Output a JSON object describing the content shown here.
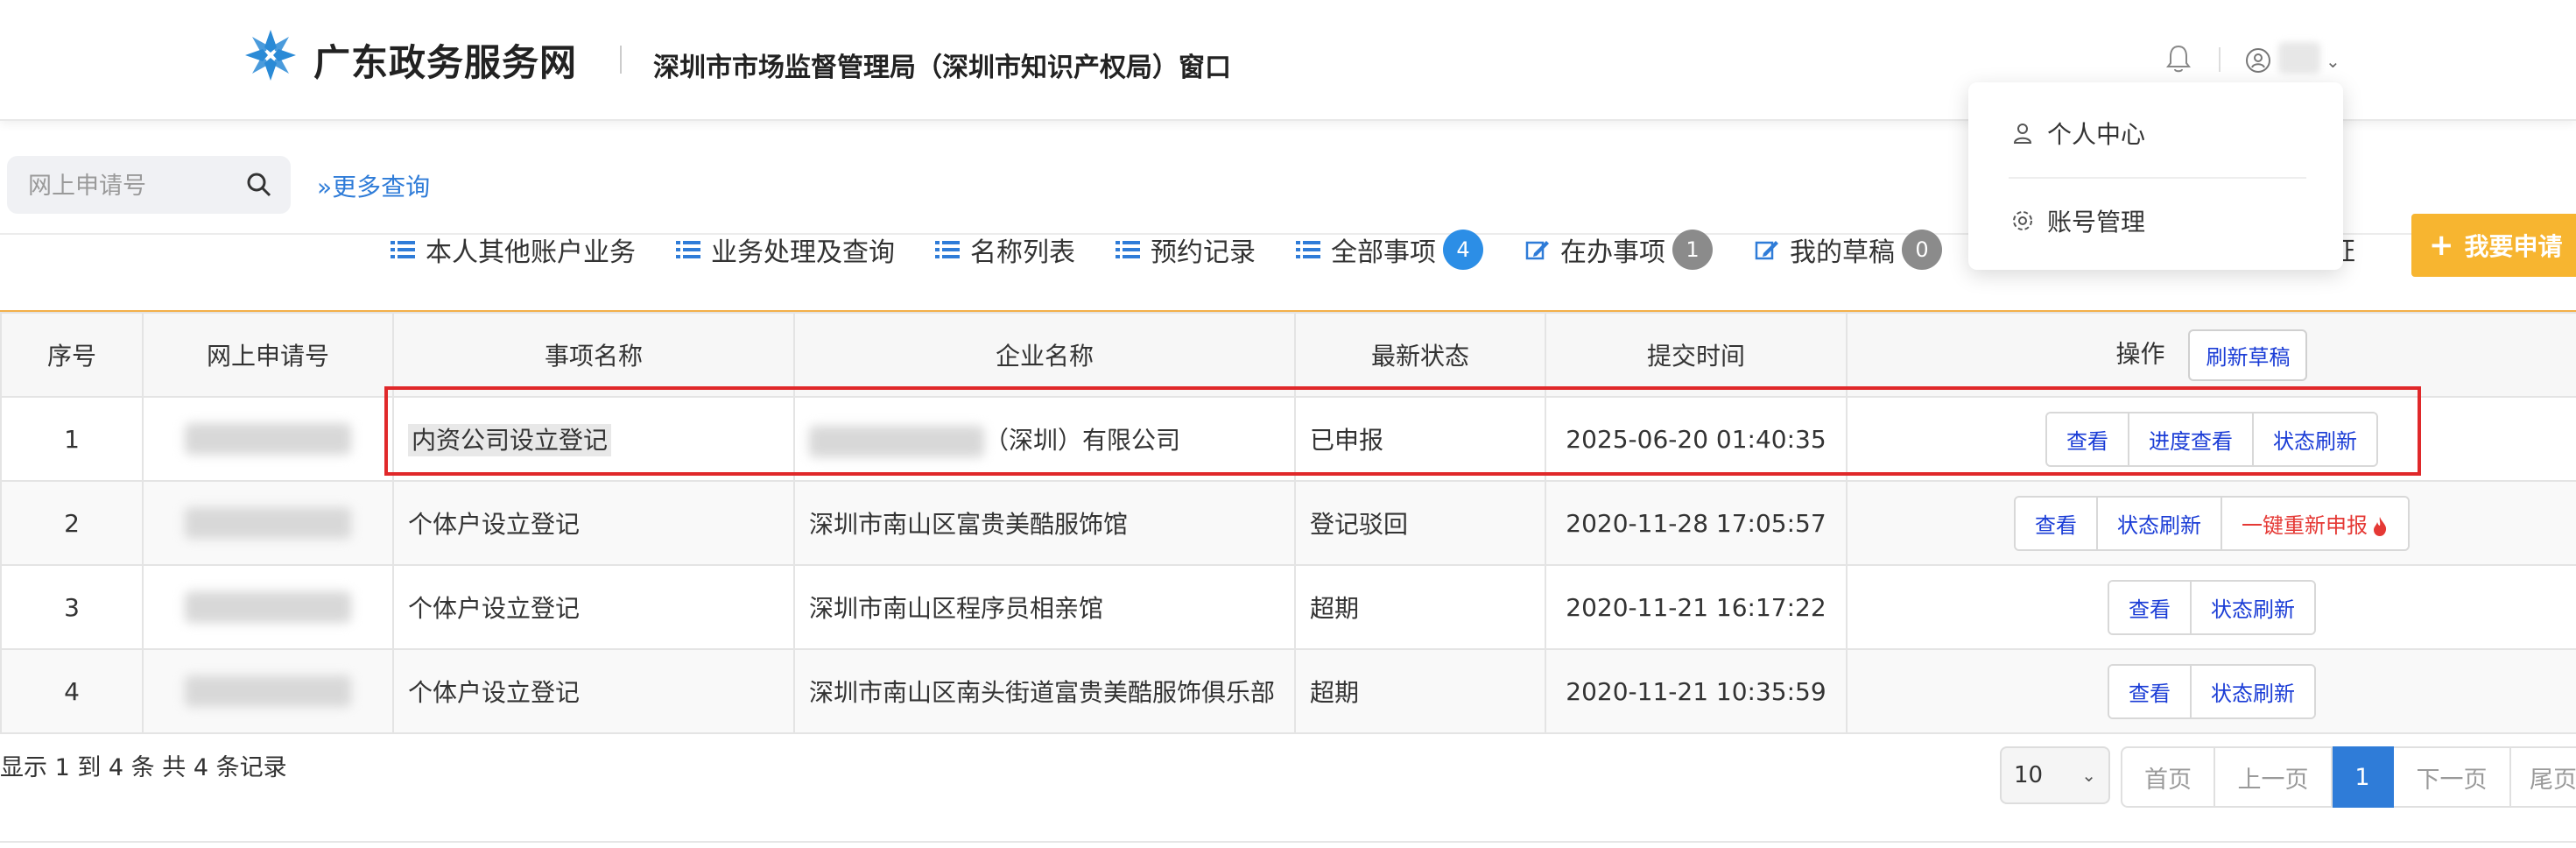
{
  "header": {
    "logo_text": "广东政务服务网",
    "dept_name": "深圳市市场监督管理局（深圳市知识产权局）窗口"
  },
  "search": {
    "placeholder": "网上申请号",
    "more_query": "更多查询"
  },
  "tabs": [
    {
      "label": "本人其他账户业务",
      "icon": "list-icon"
    },
    {
      "label": "业务处理及查询",
      "icon": "list-icon"
    },
    {
      "label": "名称列表",
      "icon": "list-icon"
    },
    {
      "label": "预约记录",
      "icon": "list-icon"
    },
    {
      "label": "全部事项",
      "icon": "list-icon",
      "badge": "4"
    },
    {
      "label": "在办事项",
      "icon": "edit-icon",
      "badge": "1"
    },
    {
      "label": "我的草稿",
      "icon": "edit-icon",
      "badge": "0"
    }
  ],
  "license_partial": "可证",
  "apply_button": "我要申请",
  "dropdown": {
    "items": [
      "个人中心",
      "账号管理"
    ]
  },
  "table": {
    "headers": [
      "序号",
      "网上申请号",
      "事项名称",
      "企业名称",
      "最新状态",
      "提交时间",
      "操作"
    ],
    "refresh_draft": "刷新草稿",
    "rows": [
      {
        "no": "1",
        "item": "内资公司设立登记",
        "company": "（深圳）有限公司",
        "status": "已申报",
        "time": "2025-06-20 01:40:35",
        "actions": [
          "查看",
          "进度查看",
          "状态刷新"
        ]
      },
      {
        "no": "2",
        "item": "个体户设立登记",
        "company": "深圳市南山区富贵美酷服饰馆",
        "status": "登记驳回",
        "time": "2020-11-28 17:05:57",
        "actions": [
          "查看",
          "状态刷新",
          "一键重新申报"
        ]
      },
      {
        "no": "3",
        "item": "个体户设立登记",
        "company": "深圳市南山区程序员相亲馆",
        "status": "超期",
        "time": "2020-11-21 16:17:22",
        "actions": [
          "查看",
          "状态刷新"
        ]
      },
      {
        "no": "4",
        "item": "个体户设立登记",
        "company": "深圳市南山区南头街道富贵美酷服饰俱乐部",
        "status": "超期",
        "time": "2020-11-21 10:35:59",
        "actions": [
          "查看",
          "状态刷新"
        ]
      }
    ]
  },
  "footer": {
    "summary": "显示 1 到 4 条 共 4 条记录",
    "page_size": "10",
    "pages": [
      "首页",
      "上一页",
      "1",
      "下一页",
      "尾页"
    ]
  },
  "colors": {
    "accent_blue": "#2f7cd8",
    "badge_blue": "#2c8ee6",
    "apply_orange": "#f7b530",
    "highlight_red": "#e0282a"
  }
}
